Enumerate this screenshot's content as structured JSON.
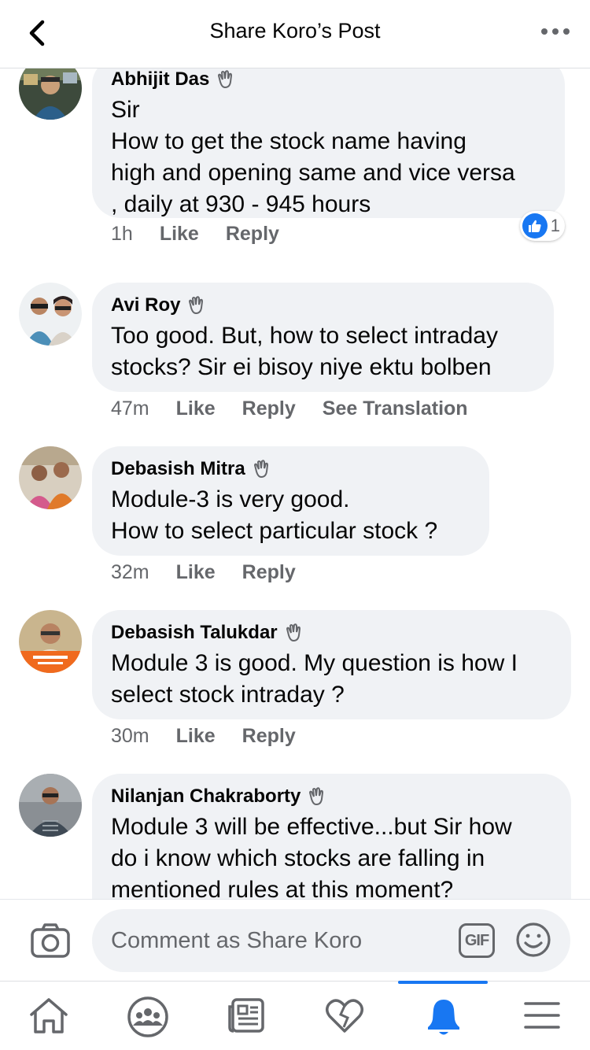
{
  "header": {
    "title": "Share Koro’s Post"
  },
  "comments": [
    {
      "name": "Abhijit Das",
      "text": "Sir\nHow to get the stock name having\nhigh and opening same and vice versa\n, daily at 930 - 945 hours",
      "time": "1h",
      "like": "Like",
      "reply": "Reply",
      "reaction_count": "1"
    },
    {
      "name": "Avi Roy",
      "text": "Too good. But, how to select intraday\nstocks? Sir ei bisoy niye ektu bolben",
      "time": "47m",
      "like": "Like",
      "reply": "Reply",
      "translate": "See Translation"
    },
    {
      "name": "Debasish Mitra",
      "text": "Module-3 is very good.\nHow to select particular stock ?",
      "time": "32m",
      "like": "Like",
      "reply": "Reply"
    },
    {
      "name": "Debasish Talukdar",
      "text": "Module 3 is good. My question is how I\nselect stock  intraday ?",
      "time": "30m",
      "like": "Like",
      "reply": "Reply"
    },
    {
      "name": "Nilanjan Chakraborty",
      "text": "Module 3 will be effective...but Sir how\ndo i know which stocks are falling in\nmentioned rules at this moment?"
    }
  ],
  "composer": {
    "placeholder": "Comment as Share Koro",
    "gif_label": "GIF"
  },
  "tabs": [
    {
      "icon": "home-icon"
    },
    {
      "icon": "groups-icon"
    },
    {
      "icon": "news-icon"
    },
    {
      "icon": "dating-heart-icon"
    },
    {
      "icon": "notifications-bell-icon",
      "active": true
    },
    {
      "icon": "menu-icon"
    }
  ],
  "colors": {
    "accent": "#1877f2",
    "bubble": "#f0f2f5",
    "secondary_text": "#65676b"
  }
}
